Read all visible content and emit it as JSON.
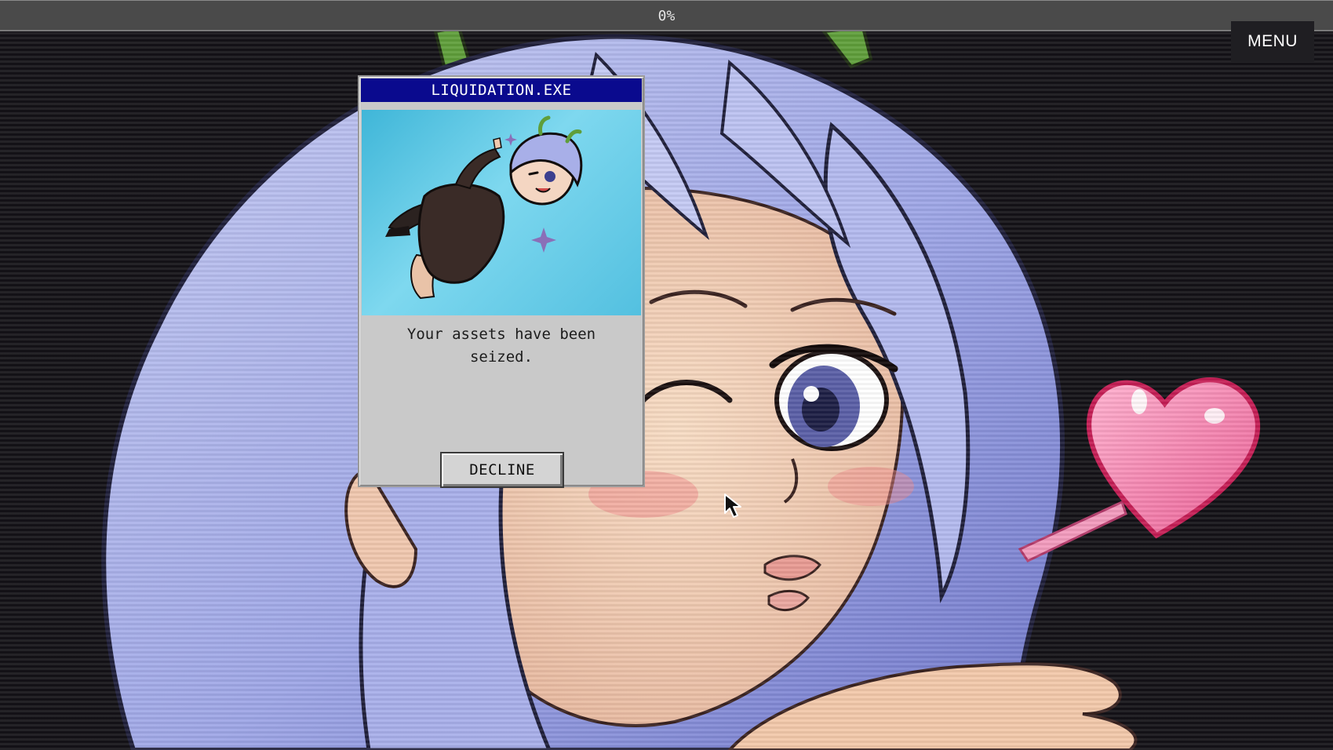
{
  "progress": {
    "value": 0,
    "label": "0%"
  },
  "menu": {
    "label": "MENU"
  },
  "popup": {
    "title": "LIQUIDATION.EXE",
    "message": "Your assets have been seized.",
    "decline_label": "DECLINE"
  },
  "colors": {
    "titlebar": "#0a0a8e",
    "window": "#c9c9c9",
    "hair": "#a9b0e8",
    "heart": "#f07aa6",
    "background": "#141217"
  },
  "icons": {
    "cursor": "arrow-cursor-icon",
    "heart": "heart-icon",
    "sparkle": "sparkle-icon"
  }
}
